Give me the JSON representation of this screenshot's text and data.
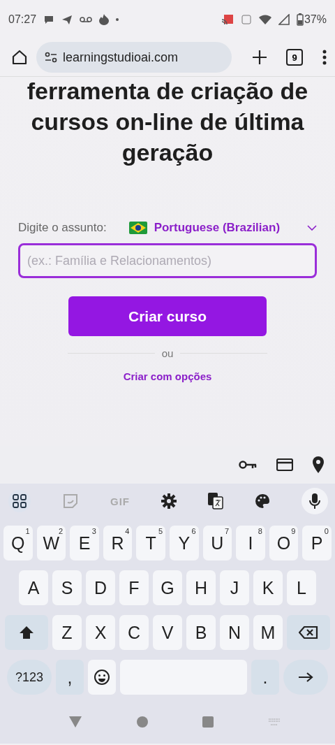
{
  "status_bar": {
    "time": "07:27",
    "battery": "37%"
  },
  "browser": {
    "url": "learningstudioai.com",
    "tab_count": "9"
  },
  "page": {
    "heading": "ferramenta de criação de cursos on-line de última geração",
    "subject_label": "Digite o assunto:",
    "language": "Portuguese (Brazilian)",
    "subject_field": {
      "placeholder": "(ex.: Família e Relacionamentos)",
      "focused": true
    },
    "create_button": "Criar curso",
    "divider_text": "ou",
    "options_link": "Criar com opções"
  },
  "keyboard": {
    "toolbar": {
      "gif": "GIF"
    },
    "rows": [
      {
        "keys": [
          {
            "kind": "char",
            "label": "Q",
            "hint": "1"
          },
          {
            "kind": "char",
            "label": "W",
            "hint": "2"
          },
          {
            "kind": "char",
            "label": "E",
            "hint": "3"
          },
          {
            "kind": "char",
            "label": "R",
            "hint": "4"
          },
          {
            "kind": "char",
            "label": "T",
            "hint": "5"
          },
          {
            "kind": "char",
            "label": "Y",
            "hint": "6"
          },
          {
            "kind": "char",
            "label": "U",
            "hint": "7"
          },
          {
            "kind": "char",
            "label": "I",
            "hint": "8"
          },
          {
            "kind": "char",
            "label": "O",
            "hint": "9"
          },
          {
            "kind": "char",
            "label": "P",
            "hint": "0"
          }
        ]
      },
      {
        "keys": [
          {
            "kind": "char",
            "label": "A"
          },
          {
            "kind": "char",
            "label": "S"
          },
          {
            "kind": "char",
            "label": "D"
          },
          {
            "kind": "char",
            "label": "F"
          },
          {
            "kind": "char",
            "label": "G"
          },
          {
            "kind": "char",
            "label": "H"
          },
          {
            "kind": "char",
            "label": "J"
          },
          {
            "kind": "char",
            "label": "K"
          },
          {
            "kind": "char",
            "label": "L"
          }
        ]
      },
      {
        "keys": [
          {
            "kind": "shift"
          },
          {
            "kind": "char",
            "label": "Z"
          },
          {
            "kind": "char",
            "label": "X"
          },
          {
            "kind": "char",
            "label": "C"
          },
          {
            "kind": "char",
            "label": "V"
          },
          {
            "kind": "char",
            "label": "B"
          },
          {
            "kind": "char",
            "label": "N"
          },
          {
            "kind": "char",
            "label": "M"
          },
          {
            "kind": "backspace"
          }
        ]
      },
      {
        "keys": [
          {
            "kind": "symbols",
            "label": "?123"
          },
          {
            "kind": "punct",
            "label": ","
          },
          {
            "kind": "emoji"
          },
          {
            "kind": "space"
          },
          {
            "kind": "punct",
            "label": "."
          },
          {
            "kind": "enter"
          }
        ]
      }
    ]
  }
}
